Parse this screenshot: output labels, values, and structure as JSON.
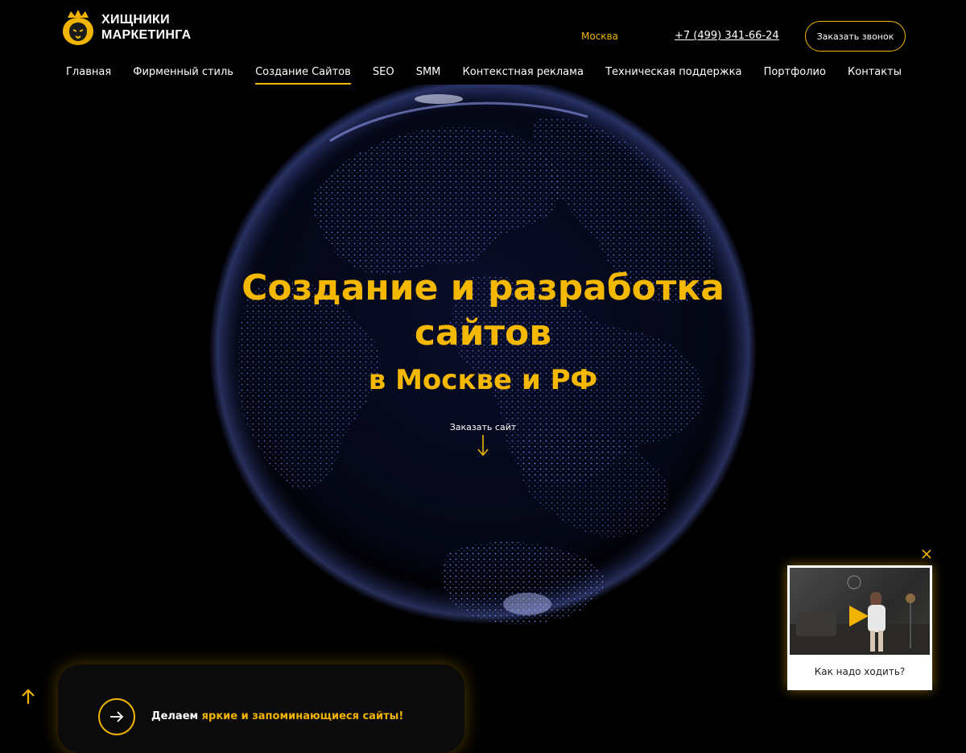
{
  "header": {
    "logo_line1": "ХИЩНИКИ",
    "logo_line2": "МАРКЕТИНГА",
    "city": "Москва",
    "phone": "+7 (499) 341-66-24",
    "callback_label": "Заказать звонок"
  },
  "nav": [
    {
      "label": "Главная"
    },
    {
      "label": "Фирменный стиль"
    },
    {
      "label": "Создание Сайтов",
      "active": true
    },
    {
      "label": "SEO"
    },
    {
      "label": "SMM"
    },
    {
      "label": "Контекстная реклама"
    },
    {
      "label": "Техническая поддержка"
    },
    {
      "label": "Портфолио"
    },
    {
      "label": "Контакты"
    }
  ],
  "hero": {
    "title_line1": "Создание и разработка",
    "title_line2": "сайтов",
    "subtitle": "в Москве и РФ",
    "order_label": "Заказать сайт"
  },
  "card": {
    "text_plain": "Делаем ",
    "text_highlight": "яркие и запоминающиеся сайты!"
  },
  "video_widget": {
    "caption": "Как надо ходить?"
  },
  "colors": {
    "accent": "#f0b400",
    "background": "#000000",
    "globe_dots": "#6f84ff"
  },
  "icons": [
    "lion-logo-icon",
    "arrow-down-icon",
    "arrow-right-icon",
    "arrow-up-icon",
    "close-icon",
    "play-icon"
  ]
}
